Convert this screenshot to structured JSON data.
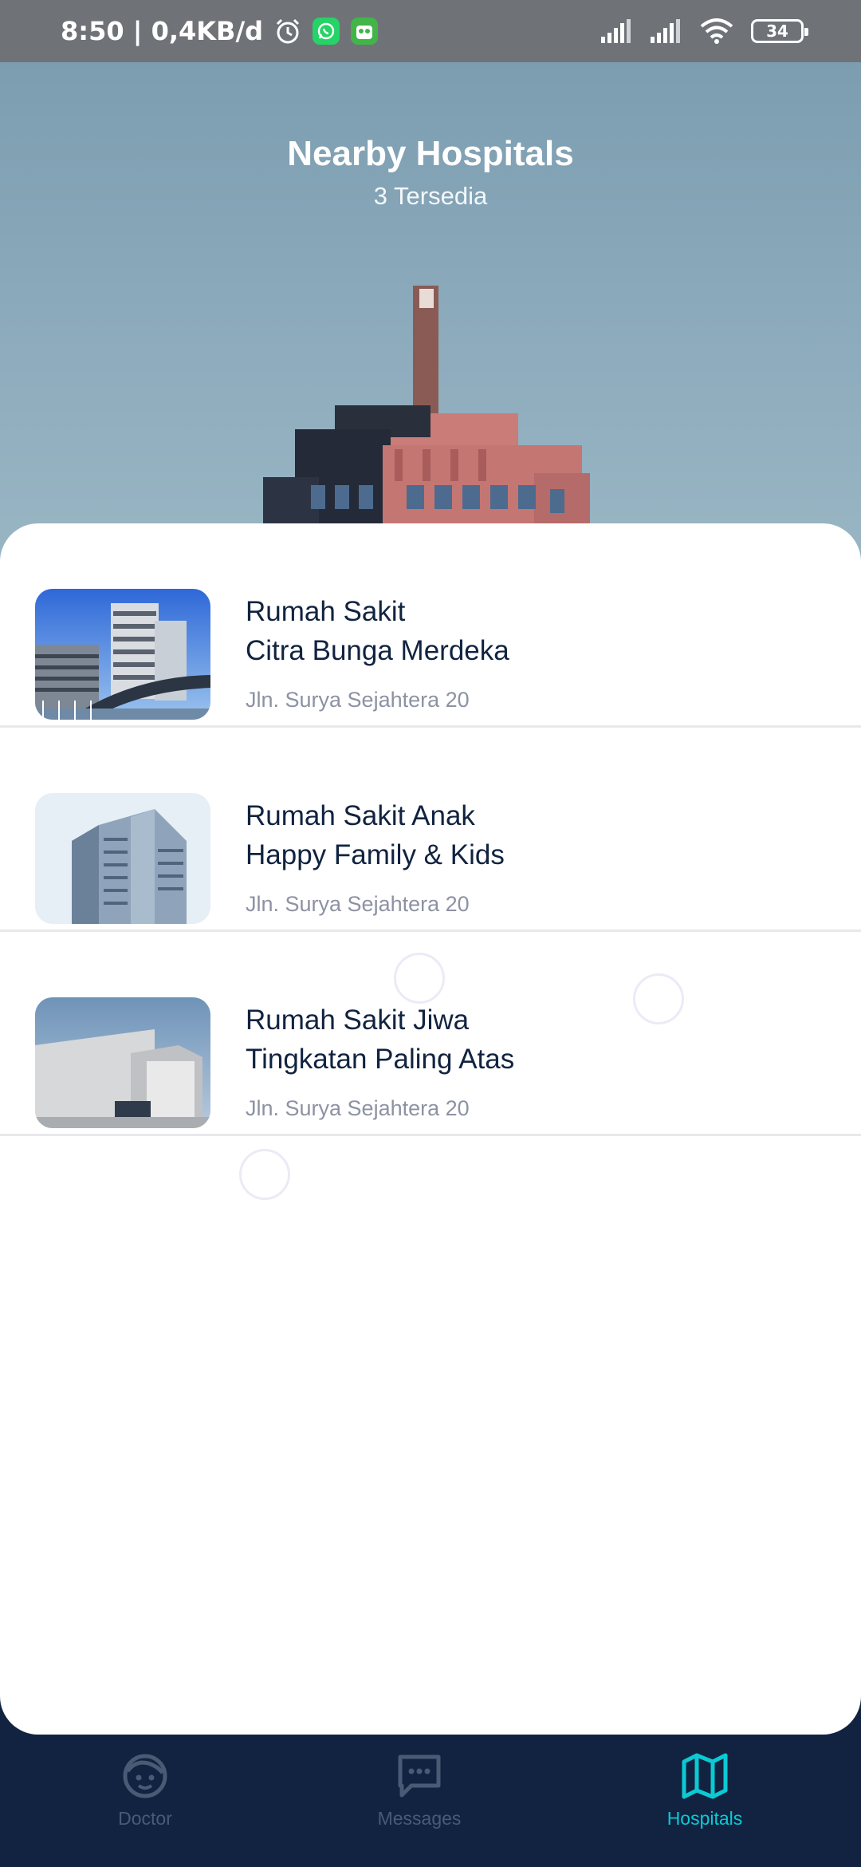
{
  "status_bar": {
    "time": "8:50 | 0,4KB/d",
    "battery": "34"
  },
  "header": {
    "title": "Nearby Hospitals",
    "subtitle": "3 Tersedia"
  },
  "hospitals": [
    {
      "name": "Rumah Sakit\nCitra Bunga Merdeka",
      "address": "Jln. Surya Sejahtera 20"
    },
    {
      "name": "Rumah Sakit Anak\nHappy Family & Kids",
      "address": "Jln. Surya Sejahtera 20"
    },
    {
      "name": "Rumah Sakit Jiwa\nTingkatan Paling Atas",
      "address": "Jln. Surya Sejahtera 20"
    }
  ],
  "nav": {
    "items": [
      {
        "label": "Doctor",
        "icon": "doctor-face-icon",
        "active": false
      },
      {
        "label": "Messages",
        "icon": "messages-icon",
        "active": false
      },
      {
        "label": "Hospitals",
        "icon": "map-icon",
        "active": true
      }
    ]
  },
  "colors": {
    "primary_dark": "#112340",
    "accent": "#0bcad4",
    "text_secondary": "#8d92a3",
    "nav_inactive": "#495a75"
  }
}
